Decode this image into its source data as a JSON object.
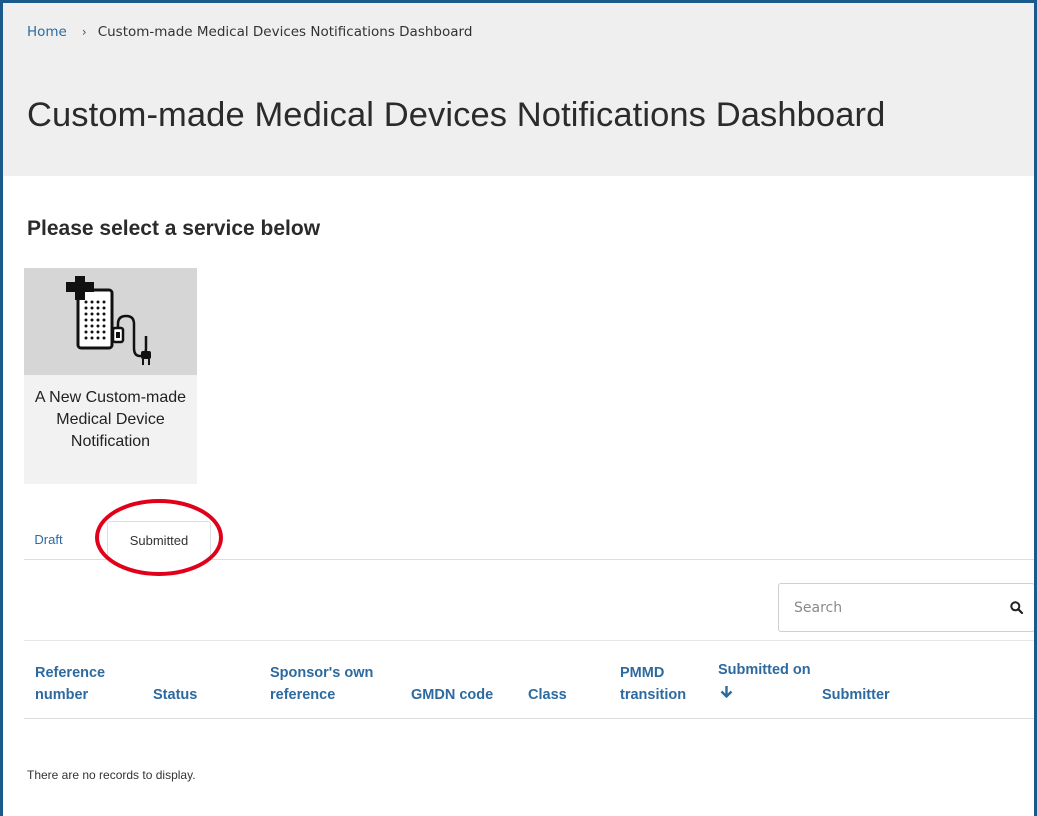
{
  "breadcrumb": {
    "home": "Home",
    "separator": "›",
    "current": "Custom-made Medical Devices Notifications Dashboard"
  },
  "page": {
    "title": "Custom-made Medical Devices Notifications Dashboard",
    "section_title": "Please select a service below"
  },
  "service_tile": {
    "icon": "medical-device-icon",
    "label": "A New Custom-made Medical Device Notification"
  },
  "tabs": [
    {
      "label": "Draft",
      "active": false
    },
    {
      "label": "Submitted",
      "active": true
    }
  ],
  "search": {
    "placeholder": "Search",
    "icon": "search-icon"
  },
  "table": {
    "columns": [
      {
        "label": "Reference number"
      },
      {
        "label": "Status"
      },
      {
        "label": "Sponsor's own reference"
      },
      {
        "label": "GMDN code"
      },
      {
        "label": "Class"
      },
      {
        "label": "PMMD transition"
      },
      {
        "label": "Submitted on",
        "sort": "descending",
        "sort_icon": "arrow-down-icon"
      },
      {
        "label": "Submitter"
      }
    ],
    "empty_message": "There are no records to display."
  },
  "colors": {
    "link": "#2c6aa0",
    "highlight_ring": "#e0001a",
    "header_band": "#efefef"
  }
}
